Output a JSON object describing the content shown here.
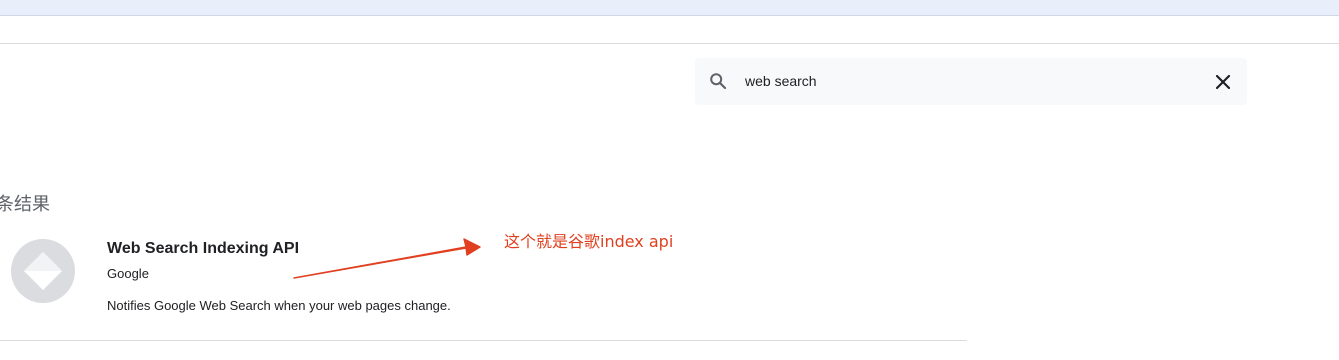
{
  "search": {
    "value": "web search",
    "placeholder": ""
  },
  "results": {
    "count_label": "条结果"
  },
  "result": {
    "title": "Web Search Indexing API",
    "provider": "Google",
    "description": "Notifies Google Web Search when your web pages change."
  },
  "annotation": {
    "text": "这个就是谷歌index api",
    "color": "#e0401f"
  },
  "icons": {
    "search": "search-icon",
    "clear": "close-icon",
    "result": "diamond-api-icon"
  },
  "colors": {
    "top_strip": "#e8effb",
    "search_bg": "#f8f9fa",
    "divider": "#dadce0",
    "icon_circle": "#dadce0"
  }
}
